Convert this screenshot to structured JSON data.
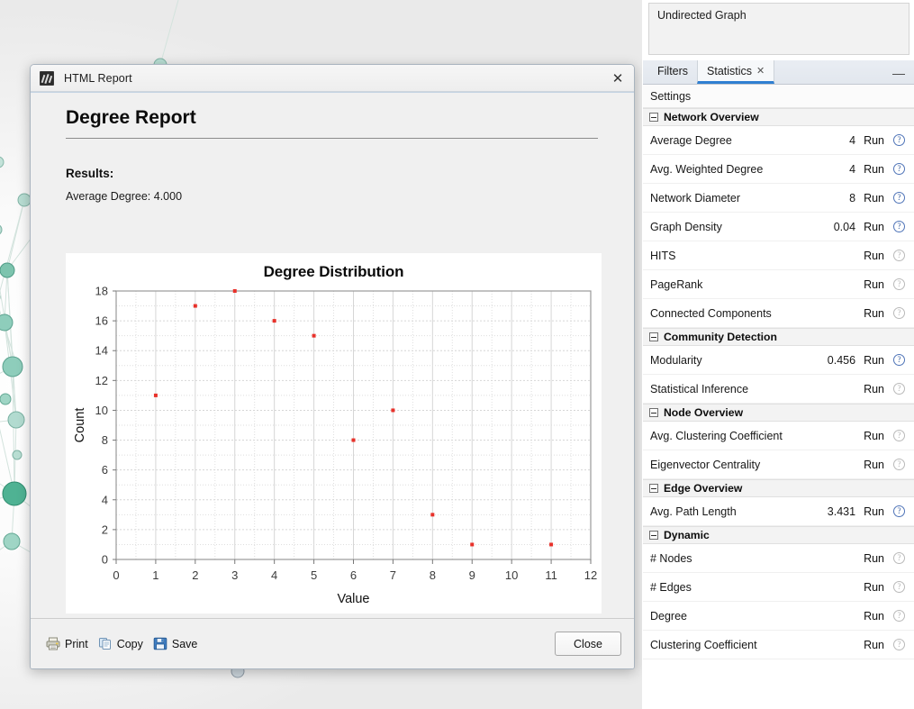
{
  "dialog": {
    "window_title": "HTML Report",
    "app_icon": "gephi-icon",
    "close_icon": "close-icon",
    "heading": "Degree Report",
    "results_label": "Results:",
    "average_degree_line": "Average Degree: 4.000",
    "footer": {
      "print_label": "Print",
      "print_icon": "printer-icon",
      "copy_label": "Copy",
      "copy_icon": "copy-icon",
      "save_label": "Save",
      "save_icon": "floppy-disk-icon",
      "close_label": "Close"
    }
  },
  "chart_data": {
    "type": "scatter",
    "title": "Degree Distribution",
    "xlabel": "Value",
    "ylabel": "Count",
    "xlim": [
      0,
      12
    ],
    "ylim": [
      0,
      18
    ],
    "xticks": [
      0,
      1,
      2,
      3,
      4,
      5,
      6,
      7,
      8,
      9,
      10,
      11,
      12
    ],
    "yticks": [
      0,
      2,
      4,
      6,
      8,
      10,
      12,
      14,
      16,
      18
    ],
    "grid": true,
    "legend": "none",
    "point_color": "#e8312a",
    "x": [
      1,
      2,
      3,
      4,
      5,
      6,
      7,
      8,
      9,
      11
    ],
    "y": [
      11,
      17,
      18,
      16,
      15,
      8,
      10,
      3,
      1,
      1
    ],
    "points": [
      {
        "x": 1,
        "y": 11
      },
      {
        "x": 2,
        "y": 17
      },
      {
        "x": 3,
        "y": 18
      },
      {
        "x": 4,
        "y": 16
      },
      {
        "x": 5,
        "y": 15
      },
      {
        "x": 6,
        "y": 8
      },
      {
        "x": 7,
        "y": 10
      },
      {
        "x": 8,
        "y": 3
      },
      {
        "x": 9,
        "y": 1
      },
      {
        "x": 11,
        "y": 1
      }
    ]
  },
  "right_panel": {
    "graph_type": "Undirected Graph",
    "tabs": [
      {
        "label": "Filters",
        "active": false,
        "closable": false
      },
      {
        "label": "Statistics",
        "active": true,
        "closable": true
      }
    ],
    "minimize_icon": "minimize-icon",
    "settings_label": "Settings",
    "run_label": "Run",
    "help_icon": "help-icon",
    "sections": [
      {
        "title": "Network Overview",
        "rows": [
          {
            "name": "Average Degree",
            "value": "4",
            "enabled": true
          },
          {
            "name": "Avg. Weighted Degree",
            "value": "4",
            "enabled": true
          },
          {
            "name": "Network Diameter",
            "value": "8",
            "enabled": true
          },
          {
            "name": "Graph Density",
            "value": "0.04",
            "enabled": true
          },
          {
            "name": "HITS",
            "value": "",
            "enabled": false
          },
          {
            "name": "PageRank",
            "value": "",
            "enabled": false
          },
          {
            "name": "Connected Components",
            "value": "",
            "enabled": false
          }
        ]
      },
      {
        "title": "Community Detection",
        "rows": [
          {
            "name": "Modularity",
            "value": "0.456",
            "enabled": true
          },
          {
            "name": "Statistical Inference",
            "value": "",
            "enabled": false
          }
        ]
      },
      {
        "title": "Node Overview",
        "rows": [
          {
            "name": "Avg. Clustering Coefficient",
            "value": "",
            "enabled": false
          },
          {
            "name": "Eigenvector Centrality",
            "value": "",
            "enabled": false
          }
        ]
      },
      {
        "title": "Edge Overview",
        "rows": [
          {
            "name": "Avg. Path Length",
            "value": "3.431",
            "enabled": true
          }
        ]
      },
      {
        "title": "Dynamic",
        "rows": [
          {
            "name": "# Nodes",
            "value": "",
            "enabled": false
          },
          {
            "name": "# Edges",
            "value": "",
            "enabled": false
          },
          {
            "name": "Degree",
            "value": "",
            "enabled": false
          },
          {
            "name": "Clustering Coefficient",
            "value": "",
            "enabled": false
          }
        ]
      }
    ]
  },
  "colors": {
    "accent": "#2f7fd1",
    "node_fill": "#8fcbbd",
    "node_stroke": "#5f9e90",
    "edge": "#cfe0da",
    "point": "#e8312a"
  }
}
